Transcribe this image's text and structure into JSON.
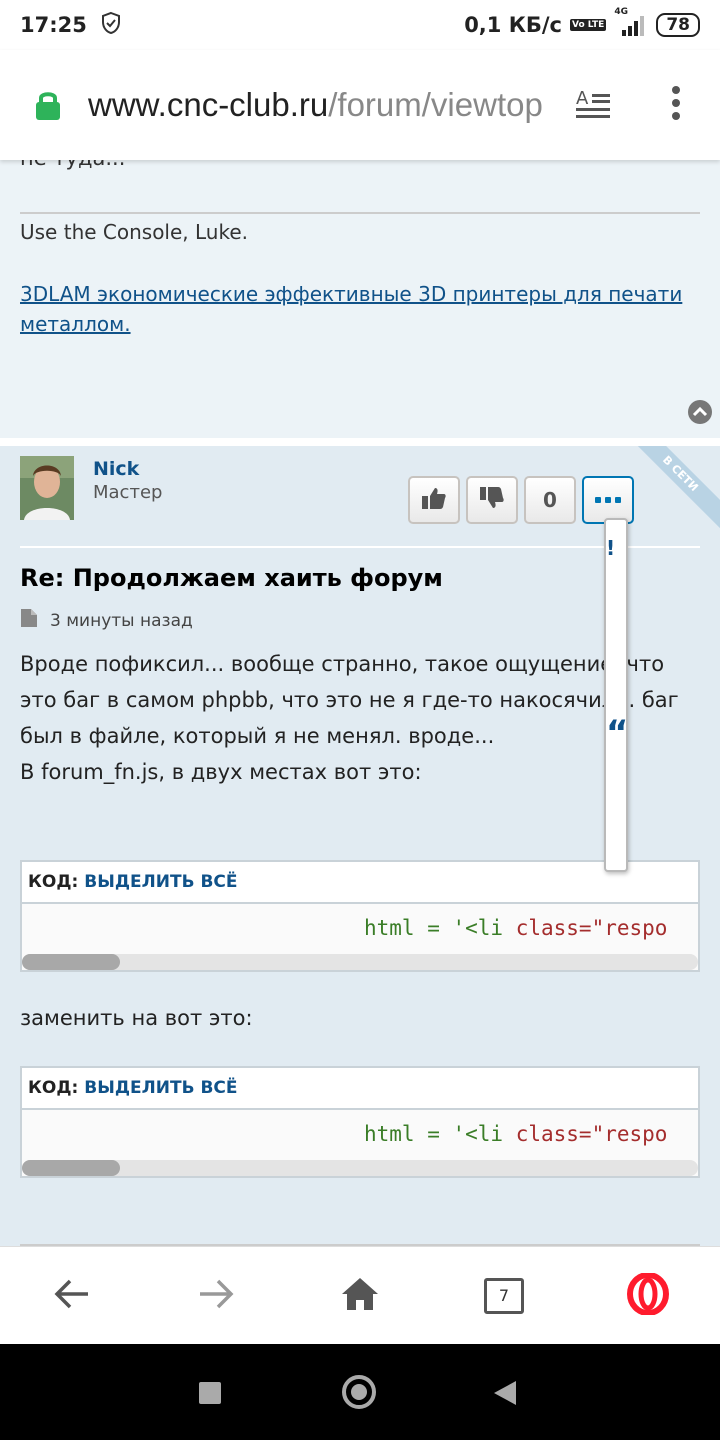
{
  "status_bar": {
    "time": "17:25",
    "network_speed": "0,1 КБ/с",
    "volte": "Vo LTE",
    "signal_label": "4G",
    "battery": "78"
  },
  "browser": {
    "url_host": "www.cnc-club.ru",
    "url_path": "/forum/viewtop",
    "tabs_count": "7"
  },
  "prev_post": {
    "cut_text": "не туда...",
    "signature": "Use the Console, Luke.",
    "signature_link": "3DLAM экономические эффективные 3D принтеры для печати металлом."
  },
  "post": {
    "author": "Nick",
    "rank": "Мастер",
    "online_ribbon": "В СЕТИ",
    "vote_count": "0",
    "title": "Re: Продолжаем хаить форум",
    "time": "3 минуты назад",
    "body": "Вроде пофиксил... вообще странно, такое ощущение, что это баг в самом phpbb, что это не я где-то накосячил... баг был в файле, который я не менял. вроде...",
    "body_line2": "В forum_fn.js, в двух местах вот это:",
    "between_text": "заменить на вот это:",
    "code_label": "КОД:",
    "select_all": "ВЫДЕЛИТЬ ВСЁ",
    "code_line_1a": "html = '<li ",
    "code_line_1b": "class=\"respo",
    "code_line_2a": "html = '<li ",
    "code_line_2b": "class=\"respo",
    "dropdown_mark_1": "!",
    "dropdown_mark_2": "“"
  },
  "colors": {
    "link": "#105289",
    "accent": "#0076b3",
    "post_bg": "#e1ebf2",
    "prev_post_bg": "#ecf3f7",
    "opera_red": "#ff1b2d"
  }
}
